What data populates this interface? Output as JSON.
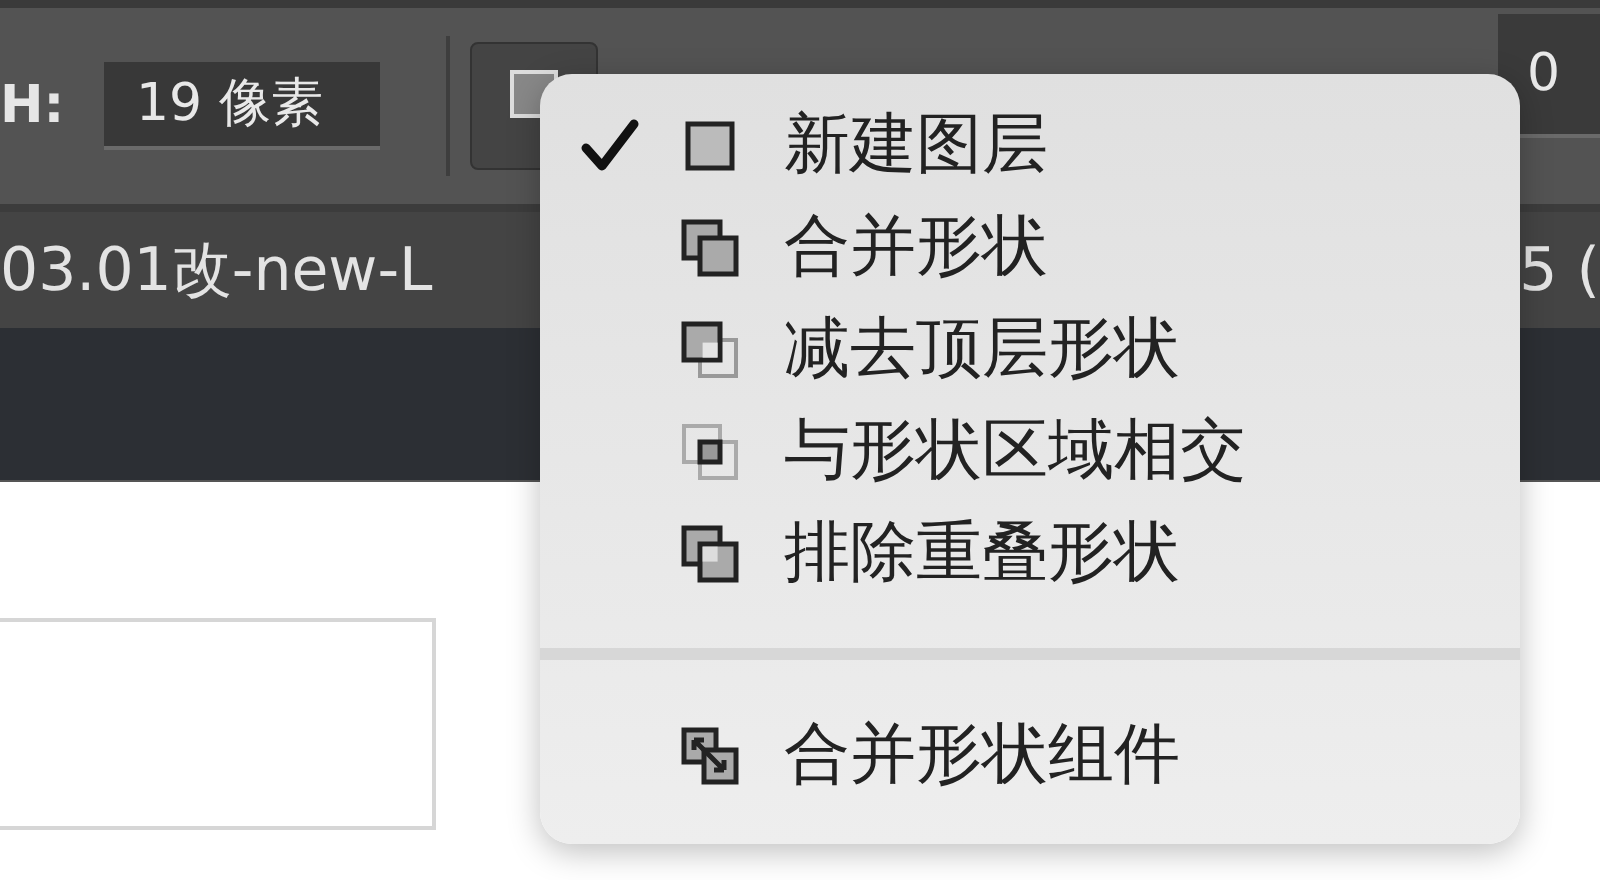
{
  "toolbar": {
    "label": "H:",
    "height_field": {
      "value": "19 像素"
    },
    "right_field": {
      "value": "0"
    }
  },
  "document_tabs": [
    {
      "label": "03.01改-new-L"
    },
    {
      "label": "5 ("
    }
  ],
  "menu": {
    "items": [
      {
        "label": "新建图层",
        "checked": true,
        "kind": "new-layer"
      },
      {
        "label": "合并形状",
        "checked": false,
        "kind": "combine"
      },
      {
        "label": "减去顶层形状",
        "checked": false,
        "kind": "subtract"
      },
      {
        "label": "与形状区域相交",
        "checked": false,
        "kind": "intersect"
      },
      {
        "label": "排除重叠形状",
        "checked": false,
        "kind": "exclude"
      }
    ],
    "footer_items": [
      {
        "label": "合并形状组件",
        "kind": "merge-components"
      }
    ]
  }
}
